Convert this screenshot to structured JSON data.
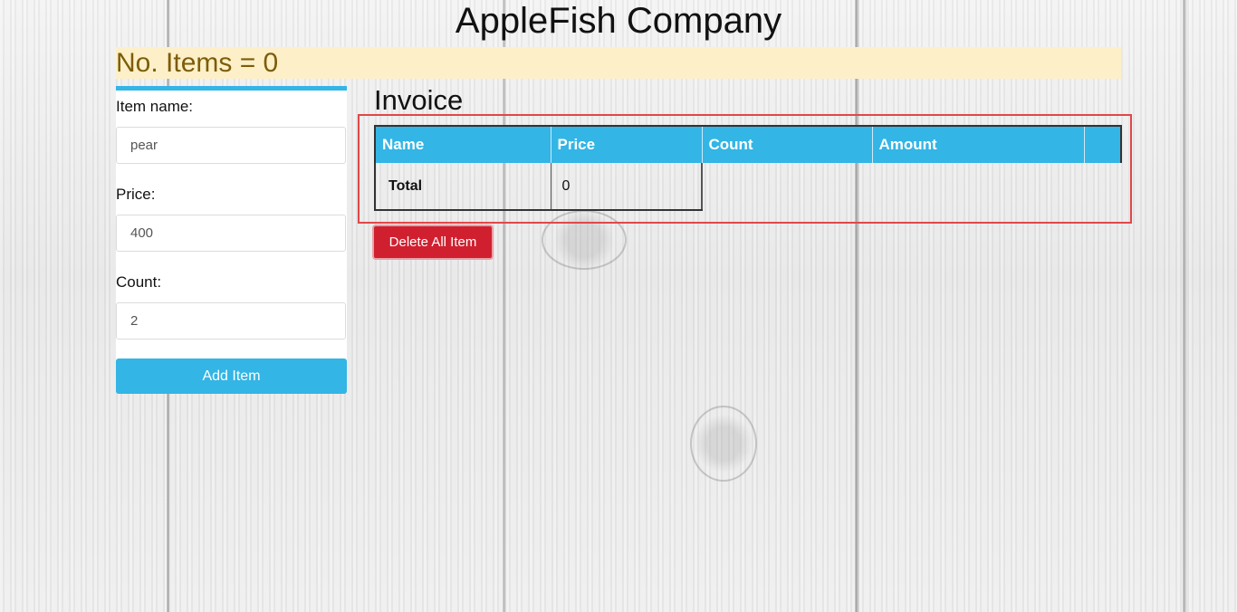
{
  "header": {
    "title": "AppleFish Company"
  },
  "summary": {
    "item_count_text": "No. Items = 0"
  },
  "form": {
    "name_label": "Item name:",
    "name_value": "pear",
    "price_label": "Price:",
    "price_value": "400",
    "count_label": "Count:",
    "count_value": "2",
    "add_button_label": "Add Item"
  },
  "invoice": {
    "heading": "Invoice",
    "columns": [
      "Name",
      "Price",
      "Count",
      "Amount",
      ""
    ],
    "total_label": "Total",
    "total_value": "0",
    "delete_button_label": "Delete All Item"
  },
  "colors": {
    "accent": "#33b5e5",
    "danger": "#d0202f",
    "highlight_bar": "#fdf0c8",
    "highlight_text": "#7d5c0a",
    "frame_border": "#e04848"
  }
}
